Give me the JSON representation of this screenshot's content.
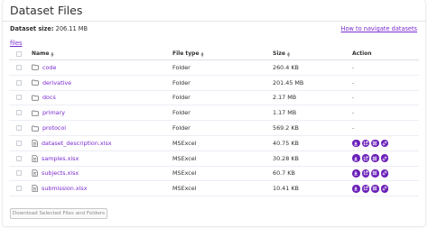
{
  "header": {
    "title": "Dataset Files",
    "size_label": "Dataset size:",
    "size_value": "206.11 MB",
    "help_link": "How to navigate datasets"
  },
  "breadcrumb": "files",
  "table": {
    "columns": {
      "name": "Name",
      "type": "File type",
      "size": "Size",
      "action": "Action"
    },
    "rows": [
      {
        "name": "code",
        "type": "Folder",
        "size": "260.4 KB",
        "action": "-",
        "kind": "folder"
      },
      {
        "name": "derivative",
        "type": "Folder",
        "size": "201.45 MB",
        "action": "-",
        "kind": "folder"
      },
      {
        "name": "docs",
        "type": "Folder",
        "size": "2.17 MB",
        "action": "-",
        "kind": "folder"
      },
      {
        "name": "primary",
        "type": "Folder",
        "size": "1.17 MB",
        "action": "-",
        "kind": "folder"
      },
      {
        "name": "protocol",
        "type": "Folder",
        "size": "569.2 KB",
        "action": "-",
        "kind": "folder"
      },
      {
        "name": "dataset_description.xlsx",
        "type": "MSExcel",
        "size": "40.75 KB",
        "action": "",
        "kind": "file"
      },
      {
        "name": "samples.xlsx",
        "type": "MSExcel",
        "size": "30.28 KB",
        "action": "",
        "kind": "file"
      },
      {
        "name": "subjects.xlsx",
        "type": "MSExcel",
        "size": "60.7 KB",
        "action": "",
        "kind": "file"
      },
      {
        "name": "submission.xlsx",
        "type": "MSExcel",
        "size": "10.41 KB",
        "action": "",
        "kind": "file"
      }
    ]
  },
  "action_icons": [
    "download-icon",
    "external-link-icon",
    "info-icon",
    "link-icon"
  ],
  "buttons": {
    "download_selected": "Download Selected Files and Folders"
  },
  "colors": {
    "accent": "#7a2bd1",
    "action_icon_bg": "#6a1fb8",
    "text": "#303133",
    "border": "#ebeef5"
  }
}
